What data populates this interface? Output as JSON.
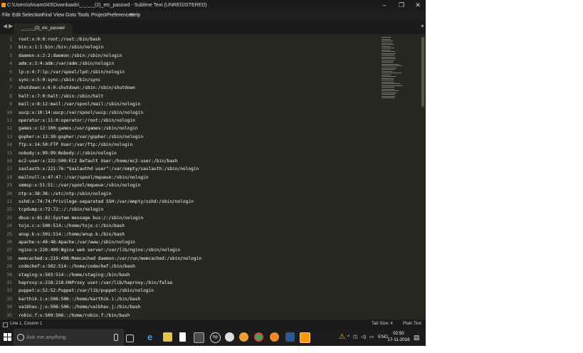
{
  "window": {
    "title": "C:\\Users\\shivam043\\Downloads\\_._._._(2)_etc_passwd - Sublime Text (UNREGISTERED)",
    "controls": [
      "–",
      "❐",
      "✕"
    ]
  },
  "menu": [
    "File",
    "Edit",
    "Selection",
    "Find",
    "View",
    "Goto",
    "Tools",
    "Project",
    "Preferences",
    "Help"
  ],
  "tab": {
    "label": "_._._._(2)_etc_passwd",
    "close": "×"
  },
  "lines": [
    {
      "n": "1",
      "t": "root:x:0:0:root:/root:/bin/bash"
    },
    {
      "n": "2",
      "t": "bin:x:1:1:bin:/bin:/sbin/nologin"
    },
    {
      "n": "3",
      "t": "daemon:x:2:2:daemon:/sbin:/sbin/nologin"
    },
    {
      "n": "4",
      "t": "adm:x:3:4:adm:/var/adm:/sbin/nologin"
    },
    {
      "n": "5",
      "t": "lp:x:4:7:lp:/var/spool/lpd:/sbin/nologin"
    },
    {
      "n": "6",
      "t": "sync:x:5:0:sync:/sbin:/bin/sync"
    },
    {
      "n": "7",
      "t": "shutdown:x:6:0:shutdown:/sbin:/sbin/shutdown"
    },
    {
      "n": "8",
      "t": "halt:x:7:0:halt:/sbin:/sbin/halt"
    },
    {
      "n": "9",
      "t": "mail:x:8:12:mail:/var/spool/mail:/sbin/nologin"
    },
    {
      "n": "10",
      "t": "uucp:x:10:14:uucp:/var/spool/uucp:/sbin/nologin"
    },
    {
      "n": "11",
      "t": "operator:x:11:0:operator:/root:/sbin/nologin"
    },
    {
      "n": "12",
      "t": "games:x:12:100:games:/usr/games:/sbin/nologin"
    },
    {
      "n": "13",
      "t": "gopher:x:13:30:gopher:/var/gopher:/sbin/nologin"
    },
    {
      "n": "14",
      "t": "ftp:x:14:50:FTP User:/var/ftp:/sbin/nologin"
    },
    {
      "n": "15",
      "t": "nobody:x:99:99:Nobody:/:/sbin/nologin"
    },
    {
      "n": "16",
      "t": "ec2-user:x:222:500:EC2 Default User:/home/ec2-user:/bin/bash"
    },
    {
      "n": "17",
      "t": "saslauth:x:221:76:\"Saslauthd user\":/var/empty/saslauth:/sbin/nologin"
    },
    {
      "n": "18",
      "t": "mailnull:x:47:47::/var/spool/mqueue:/sbin/nologin"
    },
    {
      "n": "19",
      "t": "smmsp:x:51:51::/var/spool/mqueue:/sbin/nologin"
    },
    {
      "n": "20",
      "t": "ntp:x:38:38::/etc/ntp:/sbin/nologin"
    },
    {
      "n": "21",
      "t": "sshd:x:74:74:Privilege-separated SSH:/var/empty/sshd:/sbin/nologin"
    },
    {
      "n": "22",
      "t": "tcpdump:x:72:72::/:/sbin/nologin"
    },
    {
      "n": "23",
      "t": "dbus:x:81:81:System message bus:/:/sbin/nologin"
    },
    {
      "n": "24",
      "t": "tojo.c:x:500:514::/home/tojo.c:/bin/bash"
    },
    {
      "n": "25",
      "t": "anup.k:x:501:514::/home/anup.k:/bin/bash"
    },
    {
      "n": "26",
      "t": "apache:x:48:48:Apache:/var/www:/sbin/nologin"
    },
    {
      "n": "27",
      "t": "nginx:x:220:499:Nginx web server:/var/lib/nginx:/sbin/nologin"
    },
    {
      "n": "28",
      "t": "memcached:x:219:498:Memcached daemon:/var/run/memcached:/sbin/nologin"
    },
    {
      "n": "29",
      "t": "codechef:x:502:514::/home/codechef:/bin/bash"
    },
    {
      "n": "30",
      "t": "staging:x:503:514::/home/staging:/bin/bash"
    },
    {
      "n": "31",
      "t": "haproxy:x:218:218:HAProxy user:/var/lib/haproxy:/bin/false"
    },
    {
      "n": "32",
      "t": "puppet:x:52:52:Puppet:/var/lib/puppet:/sbin/nologin"
    },
    {
      "n": "33",
      "t": "karthik.i:x:506:506::/home/karthik.i:/bin/bash"
    },
    {
      "n": "34",
      "t": "vaibhav.j:x:508:506::/home/vaibhav.j:/bin/bash"
    },
    {
      "n": "35",
      "t": "robin.f:x:509:506::/home/robin.f:/bin/bash"
    }
  ],
  "status": {
    "position": "Line 1, Column 1",
    "tab_size": "Tab Size: 4",
    "syntax": "Plain Text"
  },
  "taskbar": {
    "search_placeholder": "Ask me anything",
    "language": "ENG",
    "time": "02:50",
    "date": "17-11-2016"
  },
  "colors": {
    "editor_bg": "#272822",
    "editor_text": "#f8f8f2",
    "gutter_text": "#8f908a",
    "title_bg": "#1b1b1b",
    "taskbar_bg": "#1c1c1c"
  }
}
